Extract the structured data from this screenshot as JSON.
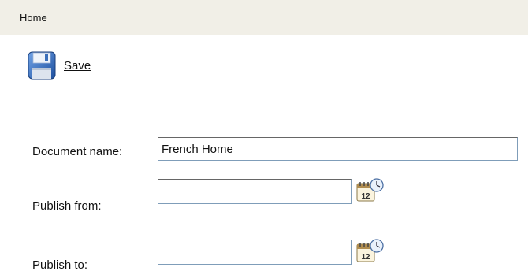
{
  "header": {
    "title": "Home"
  },
  "toolbar": {
    "save_label": "Save",
    "save_icon": "floppy-disk-icon"
  },
  "form": {
    "document_name": {
      "label": "Document name:",
      "value": "French Home"
    },
    "publish_from": {
      "label": "Publish from:",
      "value": "",
      "calendar_icon": "calendar-icon"
    },
    "publish_to": {
      "label": "Publish to:",
      "value": "",
      "calendar_icon": "calendar-icon"
    }
  },
  "colors": {
    "header_bg": "#f1efe7",
    "icon_blue": "#2a64b5"
  }
}
